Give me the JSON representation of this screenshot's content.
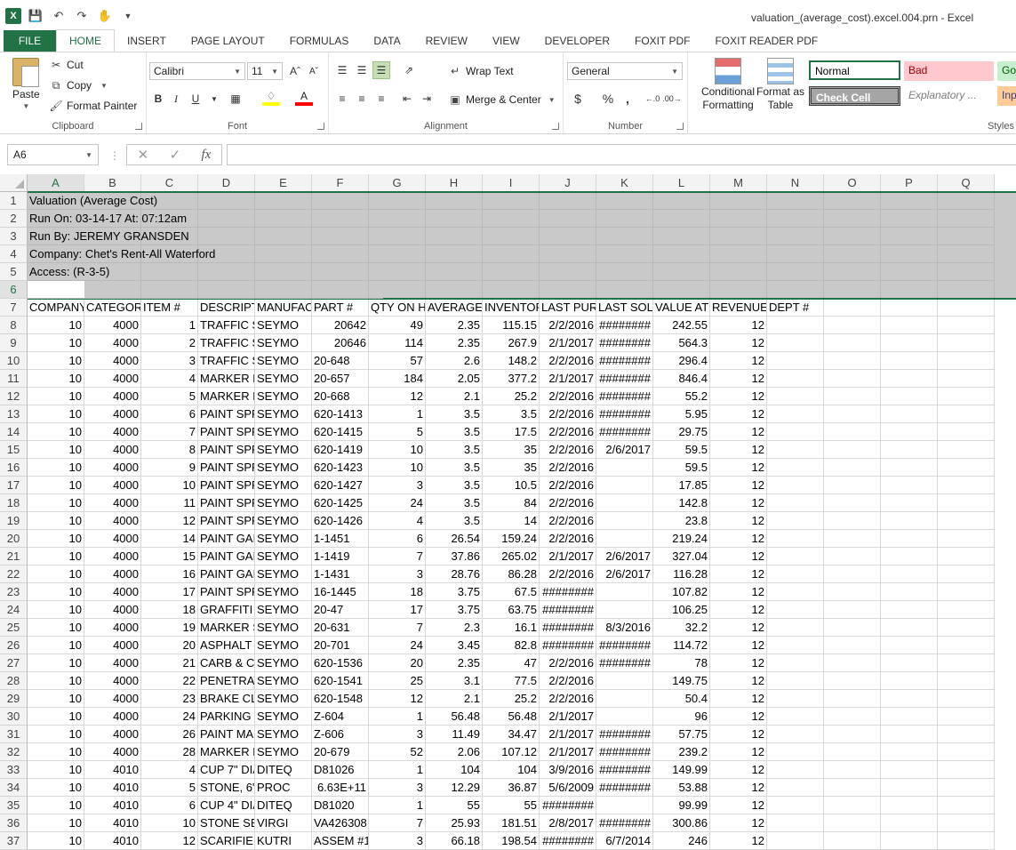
{
  "window": {
    "title": "valuation_(average_cost).excel.004.prn - Excel"
  },
  "qat": {
    "logo": "X",
    "icons": [
      "save-icon",
      "undo-icon",
      "redo-icon",
      "touch-mode-icon",
      "customize-icon"
    ]
  },
  "tabs": [
    "FILE",
    "HOME",
    "INSERT",
    "PAGE LAYOUT",
    "FORMULAS",
    "DATA",
    "REVIEW",
    "VIEW",
    "DEVELOPER",
    "FOXIT PDF",
    "FOXIT READER PDF"
  ],
  "active_tab": "HOME",
  "ribbon": {
    "clipboard": {
      "label": "Clipboard",
      "paste": "Paste",
      "cut": "Cut",
      "copy": "Copy",
      "format_painter": "Format Painter"
    },
    "font": {
      "label": "Font",
      "name": "Calibri",
      "size": "11",
      "bold": "B",
      "italic": "I",
      "underline": "U"
    },
    "alignment": {
      "label": "Alignment",
      "wrap_text": "Wrap Text",
      "merge_center": "Merge & Center"
    },
    "number": {
      "label": "Number",
      "format": "General",
      "currency": "$",
      "percent": "%",
      "comma": ","
    },
    "styles": {
      "label": "Styles",
      "conditional_formatting": "Conditional Formatting",
      "format_as_table": "Format as Table",
      "normal": "Normal",
      "bad": "Bad",
      "good": "Go",
      "check_cell": "Check Cell",
      "explanatory": "Explanatory ...",
      "input": "Inp"
    }
  },
  "formula_bar": {
    "name_box": "A6",
    "formula": ""
  },
  "colors": {
    "accent": "#217346",
    "bad_bg": "#ffc7ce",
    "bad_fg": "#9c0006",
    "good_bg": "#c6efce",
    "good_fg": "#006100",
    "check_bg": "#a5a5a5",
    "input_bg": "#ffcc99"
  },
  "sheet": {
    "columns": [
      "A",
      "B",
      "C",
      "D",
      "E",
      "F",
      "G",
      "H",
      "I",
      "J",
      "K",
      "L",
      "M",
      "N",
      "O",
      "P",
      "Q"
    ],
    "header_rows": [
      "Valuation (Average Cost)",
      "Run On: 03-14-17 At: 07:12am",
      "Run By: JEREMY GRANSDEN",
      "Company:  Chet's Rent-All Waterford",
      "Access: (R-3-5)",
      ""
    ],
    "headers": [
      "COMPANY",
      "CATEGORY",
      "ITEM #",
      "DESCRIPTI",
      "MANUFAC",
      "PART #",
      "QTY ON HA",
      "AVERAGE",
      "INVENTOF",
      "LAST PURC",
      "LAST SOLD",
      "VALUE AT",
      "REVENUE",
      "DEPT #"
    ],
    "rows": [
      [
        "10",
        "4000",
        "1",
        "TRAFFIC S",
        "SEYMO",
        "20642",
        "49",
        "2.35",
        "115.15",
        "2/2/2016",
        "########",
        "242.55",
        "12"
      ],
      [
        "10",
        "4000",
        "2",
        "TRAFFIC S",
        "SEYMO",
        "20646",
        "114",
        "2.35",
        "267.9",
        "2/1/2017",
        "########",
        "564.3",
        "12"
      ],
      [
        "10",
        "4000",
        "3",
        "TRAFFIC S",
        "SEYMO",
        "20-648",
        "57",
        "2.6",
        "148.2",
        "2/2/2016",
        "########",
        "296.4",
        "12"
      ],
      [
        "10",
        "4000",
        "4",
        "MARKER P",
        "SEYMO",
        "20-657",
        "184",
        "2.05",
        "377.2",
        "2/1/2017",
        "########",
        "846.4",
        "12"
      ],
      [
        "10",
        "4000",
        "5",
        "MARKER P",
        "SEYMO",
        "20-668",
        "12",
        "2.1",
        "25.2",
        "2/2/2016",
        "########",
        "55.2",
        "12"
      ],
      [
        "10",
        "4000",
        "6",
        "PAINT SPR",
        "SEYMO",
        "620-1413",
        "1",
        "3.5",
        "3.5",
        "2/2/2016",
        "########",
        "5.95",
        "12"
      ],
      [
        "10",
        "4000",
        "7",
        "PAINT SPR",
        "SEYMO",
        "620-1415",
        "5",
        "3.5",
        "17.5",
        "2/2/2016",
        "########",
        "29.75",
        "12"
      ],
      [
        "10",
        "4000",
        "8",
        "PAINT SPR",
        "SEYMO",
        "620-1419",
        "10",
        "3.5",
        "35",
        "2/2/2016",
        "2/6/2017",
        "59.5",
        "12"
      ],
      [
        "10",
        "4000",
        "9",
        "PAINT SPR",
        "SEYMO",
        "620-1423",
        "10",
        "3.5",
        "35",
        "2/2/2016",
        "",
        "59.5",
        "12"
      ],
      [
        "10",
        "4000",
        "10",
        "PAINT SPR",
        "SEYMO",
        "620-1427",
        "3",
        "3.5",
        "10.5",
        "2/2/2016",
        "",
        "17.85",
        "12"
      ],
      [
        "10",
        "4000",
        "11",
        "PAINT SPR",
        "SEYMO",
        "620-1425",
        "24",
        "3.5",
        "84",
        "2/2/2016",
        "",
        "142.8",
        "12"
      ],
      [
        "10",
        "4000",
        "12",
        "PAINT SPR",
        "SEYMO",
        "620-1426",
        "4",
        "3.5",
        "14",
        "2/2/2016",
        "",
        "23.8",
        "12"
      ],
      [
        "10",
        "4000",
        "14",
        "PAINT GAI",
        "SEYMO",
        "1-1451",
        "6",
        "26.54",
        "159.24",
        "2/2/2016",
        "",
        "219.24",
        "12"
      ],
      [
        "10",
        "4000",
        "15",
        "PAINT GAI",
        "SEYMO",
        "1-1419",
        "7",
        "37.86",
        "265.02",
        "2/1/2017",
        "2/6/2017",
        "327.04",
        "12"
      ],
      [
        "10",
        "4000",
        "16",
        "PAINT GAI",
        "SEYMO",
        "1-1431",
        "3",
        "28.76",
        "86.28",
        "2/2/2016",
        "2/6/2017",
        "116.28",
        "12"
      ],
      [
        "10",
        "4000",
        "17",
        "PAINT SPR",
        "SEYMO",
        "16-1445",
        "18",
        "3.75",
        "67.5",
        "########",
        "",
        "107.82",
        "12"
      ],
      [
        "10",
        "4000",
        "18",
        "GRAFFITI I",
        "SEYMO",
        "20-47",
        "17",
        "3.75",
        "63.75",
        "########",
        "",
        "106.25",
        "12"
      ],
      [
        "10",
        "4000",
        "19",
        "MARKER S",
        "SEYMO",
        "20-631",
        "7",
        "2.3",
        "16.1",
        "########",
        "8/3/2016",
        "32.2",
        "12"
      ],
      [
        "10",
        "4000",
        "20",
        "ASPHALT I",
        "SEYMO",
        "20-701",
        "24",
        "3.45",
        "82.8",
        "########",
        "########",
        "114.72",
        "12"
      ],
      [
        "10",
        "4000",
        "21",
        "CARB & CH",
        "SEYMO",
        "620-1536",
        "20",
        "2.35",
        "47",
        "2/2/2016",
        "########",
        "78",
        "12"
      ],
      [
        "10",
        "4000",
        "22",
        "PENETRAT",
        "SEYMO",
        "620-1541",
        "25",
        "3.1",
        "77.5",
        "2/2/2016",
        "",
        "149.75",
        "12"
      ],
      [
        "10",
        "4000",
        "23",
        "BRAKE CLE",
        "SEYMO",
        "620-1548",
        "12",
        "2.1",
        "25.2",
        "2/2/2016",
        "",
        "50.4",
        "12"
      ],
      [
        "10",
        "4000",
        "24",
        "PARKING I",
        "SEYMO",
        "Z-604",
        "1",
        "56.48",
        "56.48",
        "2/1/2017",
        "",
        "96",
        "12"
      ],
      [
        "10",
        "4000",
        "26",
        "PAINT MA",
        "SEYMO",
        "Z-606",
        "3",
        "11.49",
        "34.47",
        "2/1/2017",
        "########",
        "57.75",
        "12"
      ],
      [
        "10",
        "4000",
        "28",
        "MARKER P",
        "SEYMO",
        "20-679",
        "52",
        "2.06",
        "107.12",
        "2/1/2017",
        "########",
        "239.2",
        "12"
      ],
      [
        "10",
        "4010",
        "4",
        "CUP 7\" DIA",
        "DITEQ",
        "D81026",
        "1",
        "104",
        "104",
        "3/9/2016",
        "########",
        "149.99",
        "12"
      ],
      [
        "10",
        "4010",
        "5",
        "STONE, 6\"",
        "PROC",
        "6.63E+11",
        "3",
        "12.29",
        "36.87",
        "5/6/2009",
        "########",
        "53.88",
        "12"
      ],
      [
        "10",
        "4010",
        "6",
        "CUP 4\" DIA",
        "DITEQ",
        "D81020",
        "1",
        "55",
        "55",
        "########",
        "",
        "99.99",
        "12"
      ],
      [
        "10",
        "4010",
        "10",
        "STONE SET",
        "VIRGI",
        "VA426308",
        "7",
        "25.93",
        "181.51",
        "2/8/2017",
        "########",
        "300.86",
        "12"
      ],
      [
        "10",
        "4010",
        "12",
        "SCARIFIER",
        "KUTRI",
        "ASSEM #1",
        "3",
        "66.18",
        "198.54",
        "########",
        "6/7/2014",
        "246",
        "12"
      ]
    ]
  }
}
